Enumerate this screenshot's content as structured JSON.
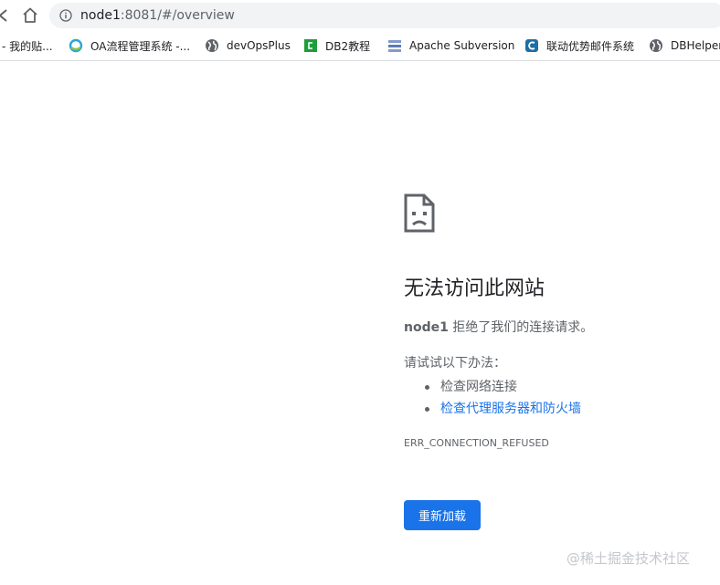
{
  "browser": {
    "url_host": "node1",
    "url_rest": ":8081/#/overview"
  },
  "bookmarks": [
    {
      "label": "- 我的贴...",
      "icon": "none"
    },
    {
      "label": "OA流程管理系统 -...",
      "icon": "oa-logo-icon"
    },
    {
      "label": "devOpsPlus",
      "icon": "globe-icon"
    },
    {
      "label": "DB2教程",
      "icon": "db2-logo-icon"
    },
    {
      "label": "Apache Subversion",
      "icon": "svn-logo-icon"
    },
    {
      "label": "联动优势邮件系统",
      "icon": "mail-logo-icon"
    },
    {
      "label": "DBHelper",
      "icon": "globe-icon"
    }
  ],
  "error": {
    "title": "无法访问此网站",
    "host": "node1",
    "description": " 拒绝了我们的连接请求。",
    "suggestions_label": "请试试以下办法：",
    "suggestions": [
      {
        "text": "检查网络连接",
        "link": false
      },
      {
        "text": "检查代理服务器和防火墙",
        "link": true
      }
    ],
    "code": "ERR_CONNECTION_REFUSED",
    "reload_label": "重新加载"
  },
  "colors": {
    "accent": "#1a73e8",
    "text_secondary": "#5f6368",
    "address_bar_bg": "#f1f3f4"
  },
  "watermark": "@稀土掘金技术社区"
}
